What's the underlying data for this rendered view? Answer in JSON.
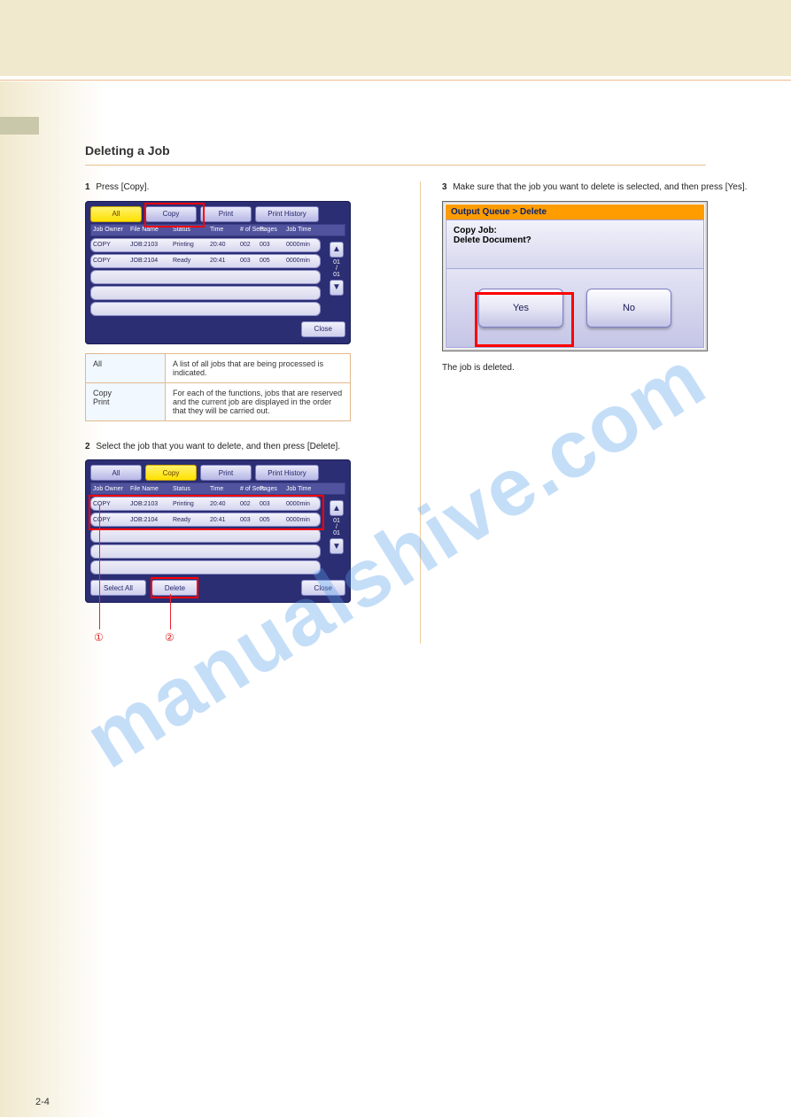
{
  "page_number": "2-4",
  "section_title": "Deleting a Job",
  "watermark": "manualshive.com",
  "left": {
    "step1": {
      "n": "1",
      "text_a": "Press",
      "btn": "[Copy]",
      "text_b": "."
    },
    "shot1": {
      "tabs": {
        "all": "All",
        "copy": "Copy",
        "print": "Print",
        "hist": "Print History"
      },
      "head": {
        "owner": "Job Owner",
        "file": "File Name",
        "status": "Status",
        "time": "Time",
        "sets": "# of\nSets",
        "pages": "Pages",
        "jtime": "Job Time"
      },
      "rows": [
        {
          "owner": "COPY",
          "file": "JOB:2103",
          "status": "Printing",
          "time": "20:40",
          "sets": "002",
          "pages": "003",
          "jtime": "0000min"
        },
        {
          "owner": "COPY",
          "file": "JOB:2104",
          "status": "Ready",
          "time": "20:41",
          "sets": "003",
          "pages": "005",
          "jtime": "0000min"
        }
      ],
      "pager": {
        "top": "01",
        "mid": "/",
        "bot": "01"
      },
      "close": "Close"
    },
    "info": {
      "r1h": "All",
      "r1c": "A list of all jobs that are being processed is indicated.",
      "r2h1": "Copy",
      "r2h2": "Print",
      "r2c": "For each of the functions, jobs that are reserved and the current job are displayed in the order that they will be carried out."
    },
    "step2": {
      "n": "2",
      "text": "Select the job that you want to delete, and then press [Delete]."
    },
    "shot2": {
      "tabs": {
        "all": "All",
        "copy": "Copy",
        "print": "Print",
        "hist": "Print History"
      },
      "head": {
        "owner": "Job Owner",
        "file": "File Name",
        "status": "Status",
        "time": "Time",
        "sets": "# of\nSets",
        "pages": "Pages",
        "jtime": "Job Time"
      },
      "rows": [
        {
          "owner": "COPY",
          "file": "JOB:2103",
          "status": "Printing",
          "time": "20:40",
          "sets": "002",
          "pages": "003",
          "jtime": "0000min"
        },
        {
          "owner": "COPY",
          "file": "JOB:2104",
          "status": "Ready",
          "time": "20:41",
          "sets": "003",
          "pages": "005",
          "jtime": "0000min"
        }
      ],
      "pager": {
        "top": "01",
        "mid": "/",
        "bot": "01"
      },
      "selectall": "Select All",
      "delete": "Delete",
      "close": "Close",
      "call1": "①",
      "call2": "②"
    }
  },
  "right": {
    "step3": {
      "n": "3",
      "text": "Make sure that the job you want to delete is selected, and then press [Yes]."
    },
    "dialog": {
      "title": "Output Queue > Delete",
      "line1": "Copy Job:",
      "line2": "Delete Document?",
      "yes": "Yes",
      "no": "No"
    },
    "note": "The job is deleted."
  }
}
